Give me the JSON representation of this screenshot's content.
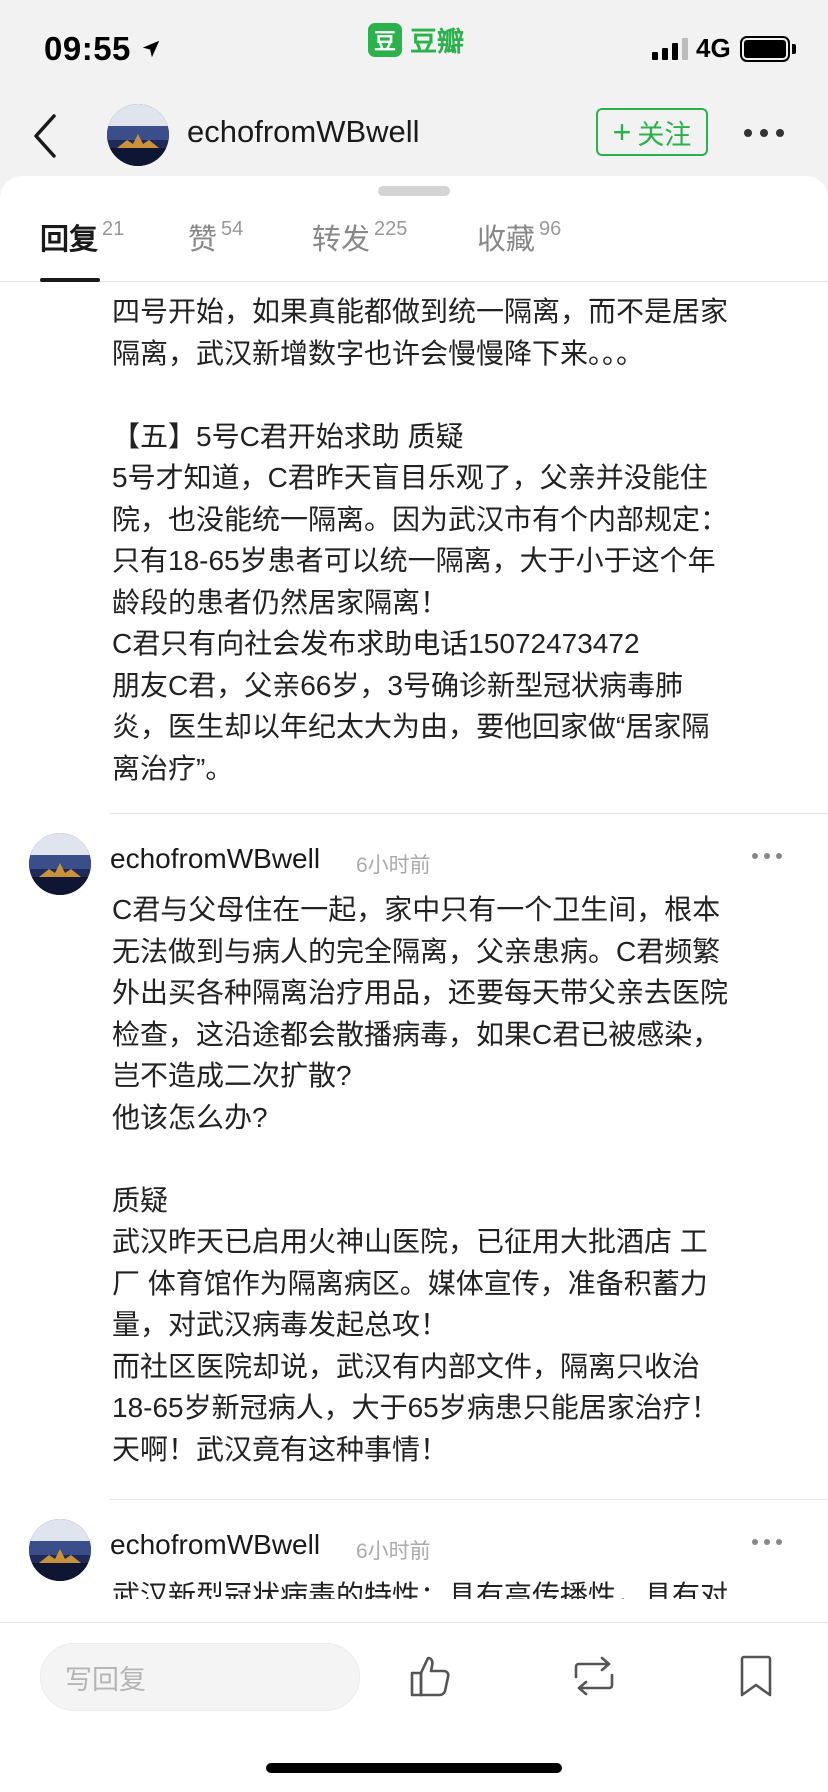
{
  "status_bar": {
    "time": "09:55",
    "app_logo_char": "豆",
    "app_name": "豆瓣",
    "network": "4G"
  },
  "header": {
    "username": "echofromWBwell",
    "follow_label": "关注"
  },
  "tabs": [
    {
      "label": "回复",
      "count": "21",
      "active": true
    },
    {
      "label": "赞",
      "count": "54",
      "active": false
    },
    {
      "label": "转发",
      "count": "225",
      "active": false
    },
    {
      "label": "收藏",
      "count": "96",
      "active": false
    }
  ],
  "post_text": [
    "四号开始，如果真能都做到统一隔离，而不是居家",
    "隔离，武汉新增数字也许会慢慢降下来。。。",
    "",
    "【五】5号C君开始求助 质疑",
    "5号才知道，C君昨天盲目乐观了，父亲并没能住",
    "院，也没能统一隔离。因为武汉市有个内部规定：",
    "只有18-65岁患者可以统一隔离，大于小于这个年",
    "龄段的患者仍然居家隔离！",
    "C君只有向社会发布求助电话15072473472",
    "朋友C君，父亲66岁，3号确诊新型冠状病毒肺",
    "炎，医生却以年纪太大为由，要他回家做“居家隔",
    "离治疗”。"
  ],
  "comments": [
    {
      "username": "echofromWBwell",
      "time": "6小时前",
      "lines": [
        "C君与父母住在一起，家中只有一个卫生间，根本",
        "无法做到与病人的完全隔离，父亲患病。C君频繁",
        "外出买各种隔离治疗用品，还要每天带父亲去医院",
        "检查，这沿途都会散播病毒，如果C君已被感染，",
        "岂不造成二次扩散?",
        "他该怎么办?",
        "",
        "质疑",
        "武汉昨天已启用火神山医院，已征用大批酒店 工",
        "厂 体育馆作为隔离病区。媒体宣传，准备积蓄力",
        "量，对武汉病毒发起总攻！",
        "而社区医院却说，武汉有内部文件，隔离只收治",
        "18-65岁新冠病人，大于65岁病患只能居家治疗！",
        "天啊！武汉竟有这种事情！"
      ]
    },
    {
      "username": "echofromWBwell",
      "time": "6小时前",
      "lines": [
        "武汉新型冠状病毒的特性：具有高传播性，具有对"
      ]
    }
  ],
  "bottom_bar": {
    "reply_placeholder": "写回复"
  },
  "icons": {
    "back": "chevron-left-icon",
    "more": "more-horizontal-icon",
    "like": "thumbs-up-icon",
    "repost": "repost-icon",
    "bookmark": "bookmark-icon",
    "location": "location-arrow-icon"
  },
  "colors": {
    "brand_green": "#2bb24c",
    "text": "#1a1a1a",
    "secondary": "#888888"
  }
}
